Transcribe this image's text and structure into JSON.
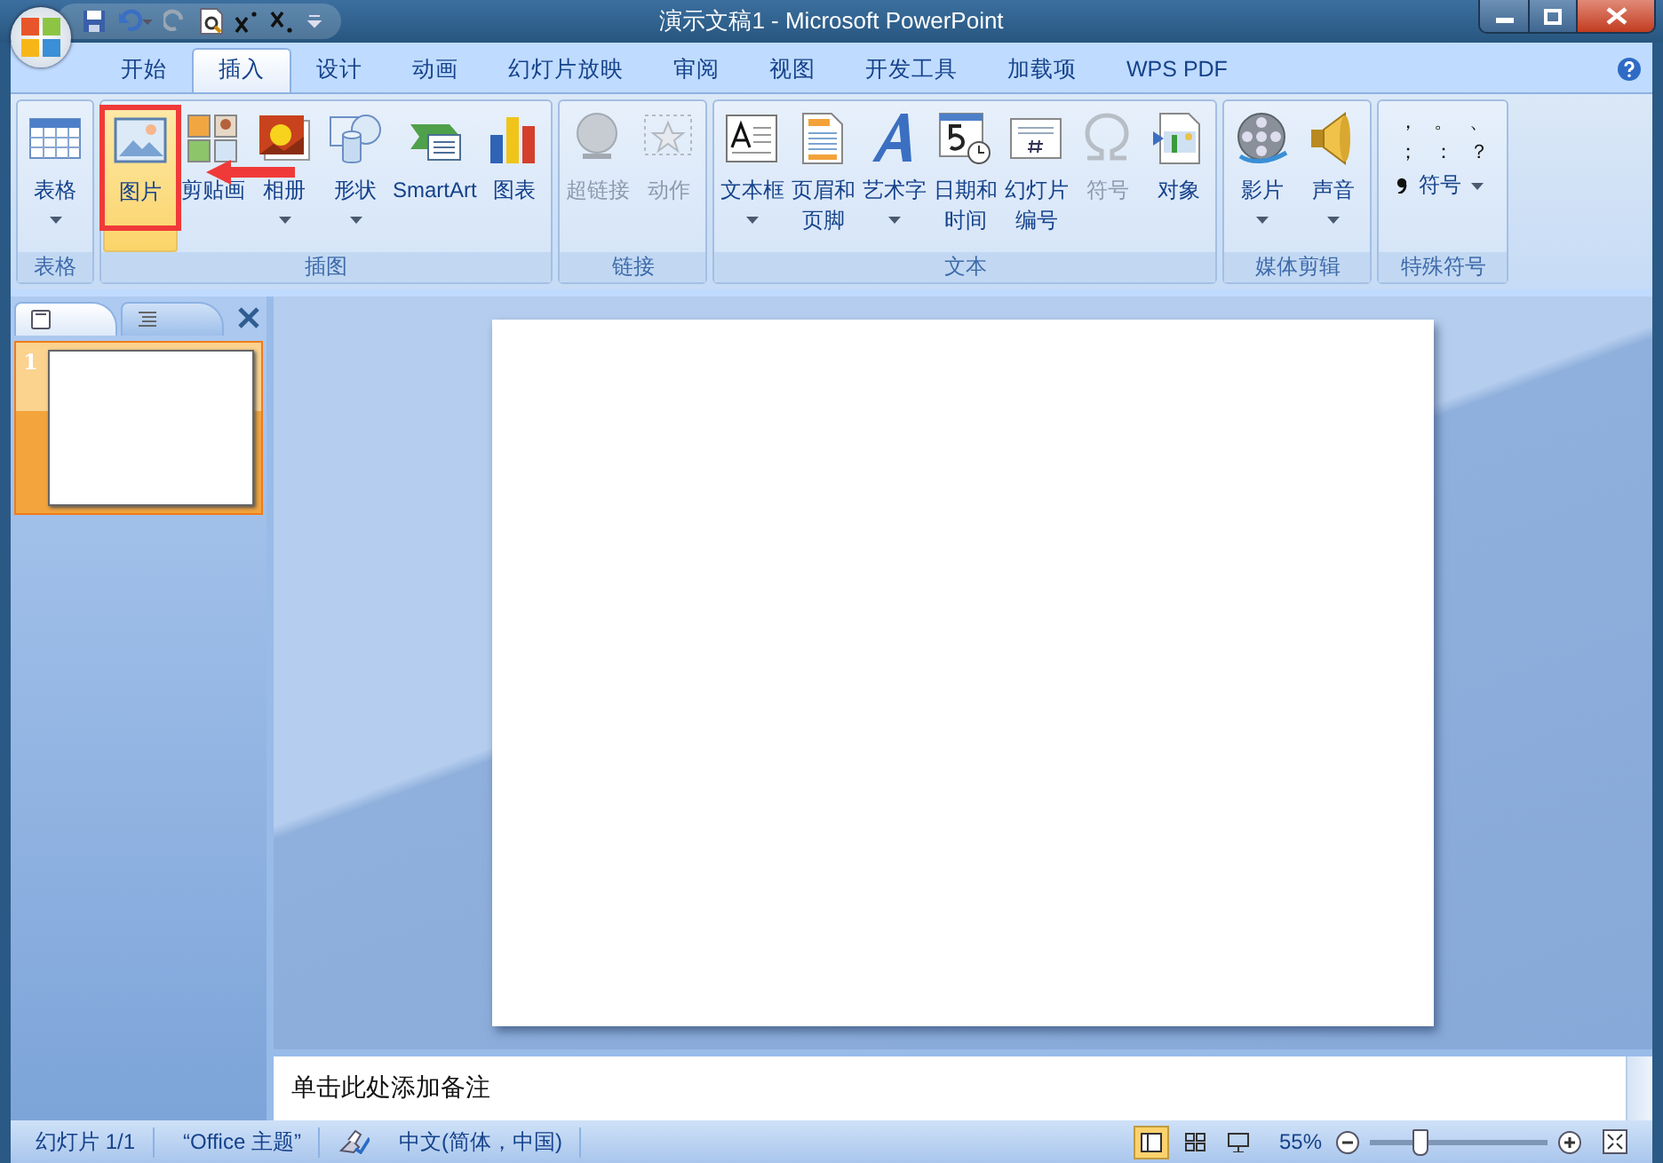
{
  "window": {
    "title": "演示文稿1 - Microsoft PowerPoint"
  },
  "tabs": [
    {
      "label": "开始",
      "selected": false
    },
    {
      "label": "插入",
      "selected": true
    },
    {
      "label": "设计",
      "selected": false
    },
    {
      "label": "动画",
      "selected": false
    },
    {
      "label": "幻灯片放映",
      "selected": false
    },
    {
      "label": "审阅",
      "selected": false
    },
    {
      "label": "视图",
      "selected": false
    },
    {
      "label": "开发工具",
      "selected": false
    },
    {
      "label": "加载项",
      "selected": false
    },
    {
      "label": "WPS PDF",
      "selected": false
    }
  ],
  "ribbon_groups": [
    {
      "name": "表格",
      "buttons": [
        {
          "label": [
            "表格"
          ],
          "dropdown": true,
          "disabled": false,
          "highlighted": false
        }
      ]
    },
    {
      "name": "插图",
      "buttons": [
        {
          "label": [
            "图片"
          ],
          "dropdown": false,
          "disabled": false,
          "highlighted": true
        },
        {
          "label": [
            "剪贴画"
          ],
          "dropdown": false,
          "disabled": false,
          "highlighted": false
        },
        {
          "label": [
            "相册"
          ],
          "dropdown": true,
          "disabled": false,
          "highlighted": false
        },
        {
          "label": [
            "形状"
          ],
          "dropdown": true,
          "disabled": false,
          "highlighted": false
        },
        {
          "label": [
            "SmartArt"
          ],
          "dropdown": false,
          "disabled": false,
          "highlighted": false
        },
        {
          "label": [
            "图表"
          ],
          "dropdown": false,
          "disabled": false,
          "highlighted": false
        }
      ]
    },
    {
      "name": "链接",
      "buttons": [
        {
          "label": [
            "超链接"
          ],
          "dropdown": false,
          "disabled": true,
          "highlighted": false
        },
        {
          "label": [
            "动作"
          ],
          "dropdown": false,
          "disabled": true,
          "highlighted": false
        }
      ]
    },
    {
      "name": "文本",
      "buttons": [
        {
          "label": [
            "文本框"
          ],
          "dropdown": true,
          "disabled": false,
          "highlighted": false
        },
        {
          "label": [
            "页眉和",
            "页脚"
          ],
          "dropdown": false,
          "disabled": false,
          "highlighted": false
        },
        {
          "label": [
            "艺术字"
          ],
          "dropdown": true,
          "disabled": false,
          "highlighted": false
        },
        {
          "label": [
            "日期和",
            "时间"
          ],
          "dropdown": false,
          "disabled": false,
          "highlighted": false
        },
        {
          "label": [
            "幻灯片",
            "编号"
          ],
          "dropdown": false,
          "disabled": false,
          "highlighted": false
        },
        {
          "label": [
            "符号"
          ],
          "dropdown": false,
          "disabled": true,
          "highlighted": false
        },
        {
          "label": [
            "对象"
          ],
          "dropdown": false,
          "disabled": false,
          "highlighted": false
        }
      ]
    },
    {
      "name": "媒体剪辑",
      "buttons": [
        {
          "label": [
            "影片"
          ],
          "dropdown": true,
          "disabled": false,
          "highlighted": false
        },
        {
          "label": [
            "声音"
          ],
          "dropdown": true,
          "disabled": false,
          "highlighted": false
        }
      ]
    }
  ],
  "special_symbols": {
    "name": "特殊符号",
    "symbols": [
      "，",
      "。",
      "、",
      "；",
      "：",
      "？"
    ],
    "button": "符号"
  },
  "slide_pane": {
    "tabs": [
      {
        "kind": "slides",
        "selected": true
      },
      {
        "kind": "outline",
        "selected": false
      }
    ],
    "thumbnails": [
      {
        "number": "1",
        "selected": true
      }
    ]
  },
  "notes": {
    "placeholder": "单击此处添加备注"
  },
  "status_bar": {
    "slide": "幻灯片 1/1",
    "theme": "“Office 主题”",
    "language": "中文(简体，中国)",
    "views": [
      {
        "kind": "normal",
        "selected": true
      },
      {
        "kind": "sorter",
        "selected": false
      },
      {
        "kind": "show",
        "selected": false
      }
    ],
    "zoom": "55%",
    "zoom_level": {
      "level": 0.27
    }
  }
}
